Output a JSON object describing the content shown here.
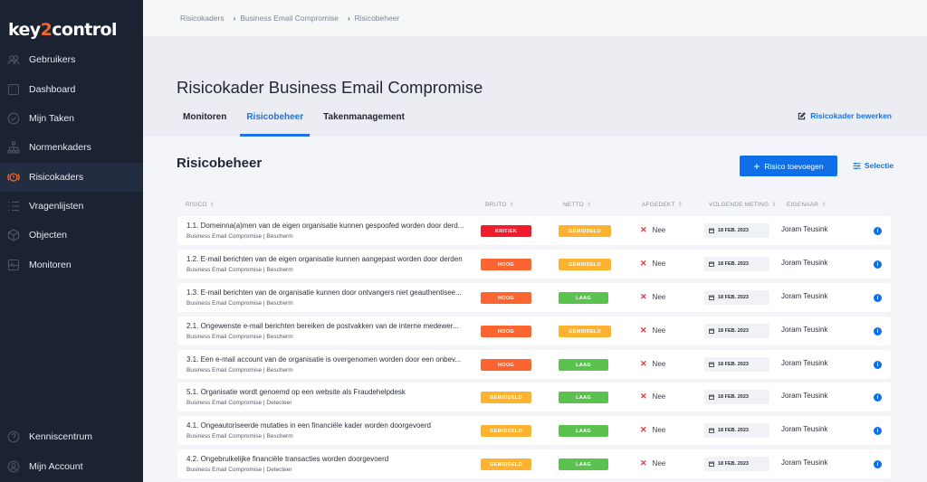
{
  "app": {
    "logo_prefix": "key",
    "logo_two": "2",
    "logo_suffix": "control"
  },
  "sidebar": {
    "items": [
      {
        "label": "Gebruikers",
        "icon": "users-icon",
        "active": false
      },
      {
        "label": "Dashboard",
        "icon": "dashboard-icon",
        "active": false
      },
      {
        "label": "Mijn Taken",
        "icon": "check-circle-icon",
        "active": false
      },
      {
        "label": "Normenkaders",
        "icon": "hierarchy-icon",
        "active": false
      },
      {
        "label": "Risicokaders",
        "icon": "alert-ring-icon",
        "active": true
      },
      {
        "label": "Vragenlijsten",
        "icon": "list-icon",
        "active": false
      },
      {
        "label": "Objecten",
        "icon": "cube-icon",
        "active": false
      },
      {
        "label": "Monitoren",
        "icon": "monitor-icon",
        "active": false
      }
    ],
    "bottom_items": [
      {
        "label": "Kenniscentrum",
        "icon": "help-circle-icon"
      },
      {
        "label": "Mijn Account",
        "icon": "account-icon"
      }
    ]
  },
  "breadcrumb": [
    "Risicokaders",
    "Business Email Compromise",
    "Risicobeheer"
  ],
  "header": {
    "title": "Risicokader Business Email Compromise",
    "tabs": [
      {
        "label": "Monitoren",
        "active": false
      },
      {
        "label": "Risicobeheer",
        "active": true
      },
      {
        "label": "Takenmanagement",
        "active": false
      }
    ],
    "edit_label": "Risicokader bewerken"
  },
  "section": {
    "title": "Risicobeheer",
    "add_label": "Risico toevoegen",
    "filter_label": "Selectie"
  },
  "table": {
    "columns": [
      "RISICO",
      "BRUTO",
      "NETTO",
      "AFGEDEKT",
      "VOLGENDE METING",
      "EIGENAAR"
    ],
    "rows": [
      {
        "title": "1.1. Domeinna(a)men van de eigen organisatie kunnen gespoofed worden door derd...",
        "sub": "Business Email Compromise | Bescherm",
        "bruto": "KRITIEK",
        "netto": "GEMIDDELD",
        "covered": "Nee",
        "date": "18 FEB. 2023",
        "owner": "Joram Teusink"
      },
      {
        "title": "1.2. E-mail berichten van de eigen organisatie kunnen aangepast worden door derden",
        "sub": "Business Email Compromise | Bescherm",
        "bruto": "HOOG",
        "netto": "GEMIDDELD",
        "covered": "Nee",
        "date": "18 FEB. 2023",
        "owner": "Joram Teusink"
      },
      {
        "title": "1.3. E-mail berichten van de organisatie kunnen door ontvangers niet geauthentisee...",
        "sub": "Business Email Compromise | Bescherm",
        "bruto": "HOOG",
        "netto": "LAAG",
        "covered": "Nee",
        "date": "18 FEB. 2023",
        "owner": "Joram Teusink"
      },
      {
        "title": "2.1. Ongewenste e-mail berichten bereiken de postvakken van de interne medewer...",
        "sub": "Business Email Compromise | Bescherm",
        "bruto": "HOOG",
        "netto": "GEMIDDELD",
        "covered": "Nee",
        "date": "18 FEB. 2023",
        "owner": "Joram Teusink"
      },
      {
        "title": "3.1. Een e-mail account van de organisatie is overgenomen worden door een onbev...",
        "sub": "Business Email Compromise | Bescherm",
        "bruto": "HOOG",
        "netto": "LAAG",
        "covered": "Nee",
        "date": "18 FEB. 2023",
        "owner": "Joram Teusink"
      },
      {
        "title": "5.1. Organisatie wordt genoemd op een website als Fraudehelpdesk",
        "sub": "Business Email Compromise | Detecteer",
        "bruto": "GEMIDDELD",
        "netto": "LAAG",
        "covered": "Nee",
        "date": "18 FEB. 2023",
        "owner": "Joram Teusink"
      },
      {
        "title": "4.1. Ongeautoriseerde mutaties in een financiële kader worden doorgevoerd",
        "sub": "Business Email Compromise | Bescherm",
        "bruto": "GEMIDDELD",
        "netto": "LAAG",
        "covered": "Nee",
        "date": "18 FEB. 2023",
        "owner": "Joram Teusink"
      },
      {
        "title": "4.2. Ongebruikelijke financiële transacties worden doorgevoerd",
        "sub": "Business Email Compromise | Detecteer",
        "bruto": "GEMIDDELD",
        "netto": "LAAG",
        "covered": "Nee",
        "date": "18 FEB. 2023",
        "owner": "Joram Teusink"
      }
    ]
  },
  "colors": {
    "sidebar_bg": "#1b2333",
    "accent": "#1a73e8",
    "logo_accent": "#f0662a",
    "KRITIEK": "#f01c2c",
    "HOOG": "#fc6430",
    "GEMIDDELD": "#fdb32f",
    "LAAG": "#5cc24f"
  },
  "icons": {
    "sort": "⇕",
    "covered_no": "✕",
    "info": "i",
    "plus": "+"
  }
}
